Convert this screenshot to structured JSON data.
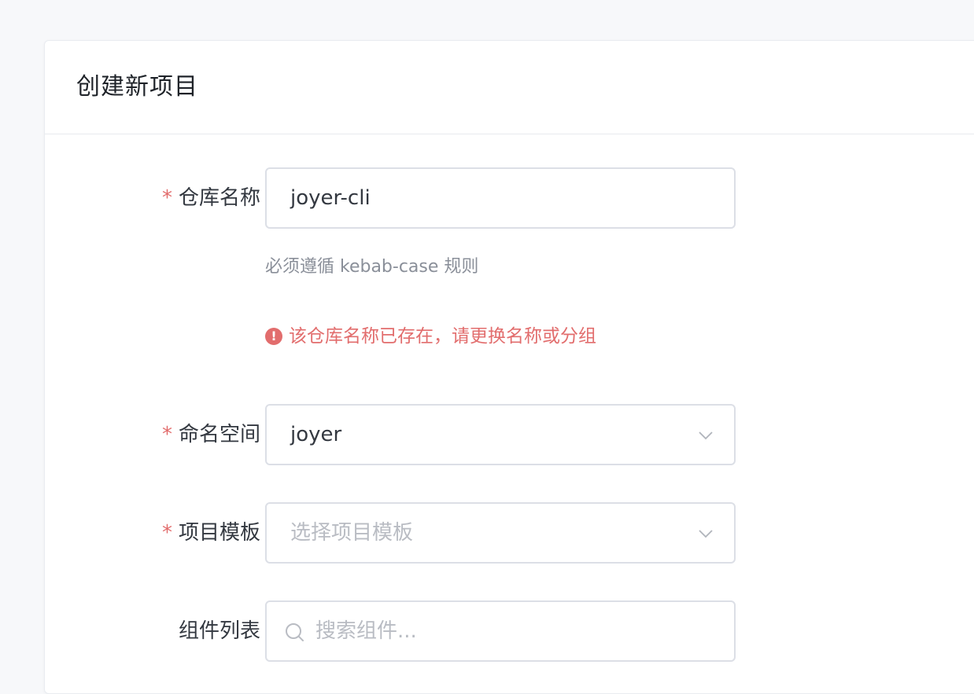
{
  "dialog": {
    "title": "创建新项目"
  },
  "form": {
    "repo_name": {
      "required_mark": "*",
      "label": "仓库名称",
      "value": "joyer-cli",
      "help": "必须遵循 kebab-case 规则",
      "error_icon": "!",
      "error": "该仓库名称已存在，请更换名称或分组"
    },
    "namespace": {
      "required_mark": "*",
      "label": "命名空间",
      "value": "joyer",
      "icon": "chevron-down-icon"
    },
    "template": {
      "required_mark": "*",
      "label": "项目模板",
      "placeholder": "选择项目模板",
      "icon": "chevron-down-icon"
    },
    "components": {
      "label": "组件列表",
      "placeholder": "搜索组件...",
      "icon": "search-icon"
    }
  },
  "colors": {
    "error": "#e26d6d",
    "border": "#dcdfe6",
    "placeholder": "#b9bcc3"
  }
}
